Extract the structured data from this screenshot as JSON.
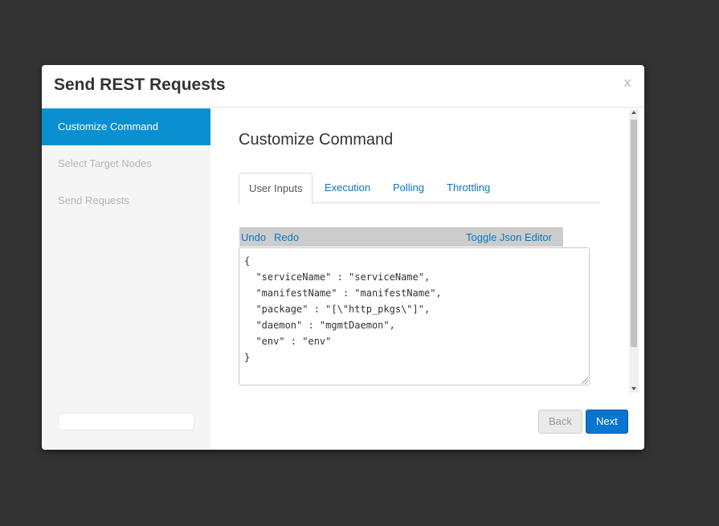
{
  "dialog": {
    "title": "Send REST Requests",
    "close_label": "x"
  },
  "sidebar": {
    "steps": [
      {
        "label": "Customize Command",
        "active": true
      },
      {
        "label": "Select Target Nodes",
        "active": false
      },
      {
        "label": "Send Requests",
        "active": false
      }
    ]
  },
  "main": {
    "section_title": "Customize Command",
    "tabs": [
      {
        "label": "User Inputs",
        "active": true
      },
      {
        "label": "Execution",
        "active": false
      },
      {
        "label": "Polling",
        "active": false
      },
      {
        "label": "Throttling",
        "active": false
      }
    ],
    "toolbar": {
      "undo": "Undo",
      "redo": "Redo",
      "toggle": "Toggle Json Editor"
    },
    "editor_text": "{\n  \"serviceName\" : \"serviceName\",\n  \"manifestName\" : \"manifestName\",\n  \"package\" : \"[\\\"http_pkgs\\\"]\",\n  \"daemon\" : \"mgmtDaemon\",\n  \"env\" : \"env\"\n}"
  },
  "footer": {
    "back_label": "Back",
    "next_label": "Next"
  },
  "colors": {
    "accent": "#0a8fd1",
    "primary_button": "#0a74d1",
    "backdrop": "#333333"
  }
}
